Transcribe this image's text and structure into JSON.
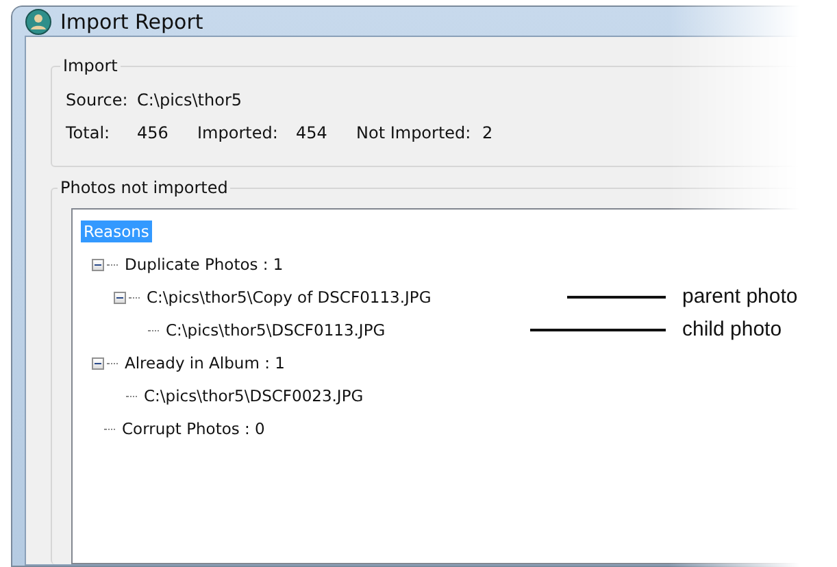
{
  "window": {
    "title": "Import Report"
  },
  "import_group": {
    "title": "Import",
    "source_label": "Source:",
    "source_value": "C:\\pics\\thor5",
    "total_label": "Total:",
    "total_value": "456",
    "imported_label": "Imported:",
    "imported_value": "454",
    "not_imported_label": "Not Imported:",
    "not_imported_value": "2"
  },
  "not_imported_group": {
    "title": "Photos not imported",
    "tree": [
      {
        "label": "Reasons",
        "selected": true,
        "children": [
          {
            "label": "Duplicate Photos : 1",
            "selected": false,
            "expanded": true,
            "children": [
              {
                "label": "C:\\pics\\thor5\\Copy of DSCF0113.JPG",
                "selected": false,
                "expanded": true,
                "children": [
                  {
                    "label": "C:\\pics\\thor5\\DSCF0113.JPG",
                    "selected": false
                  }
                ]
              }
            ]
          },
          {
            "label": "Already in Album : 1",
            "selected": false,
            "expanded": true,
            "children": [
              {
                "label": "C:\\pics\\thor5\\DSCF0023.JPG",
                "selected": false
              }
            ]
          },
          {
            "label": "Corrupt Photos : 0",
            "selected": false
          }
        ]
      }
    ]
  },
  "callouts": [
    {
      "label": "parent photo"
    },
    {
      "label": "child photo"
    }
  ]
}
